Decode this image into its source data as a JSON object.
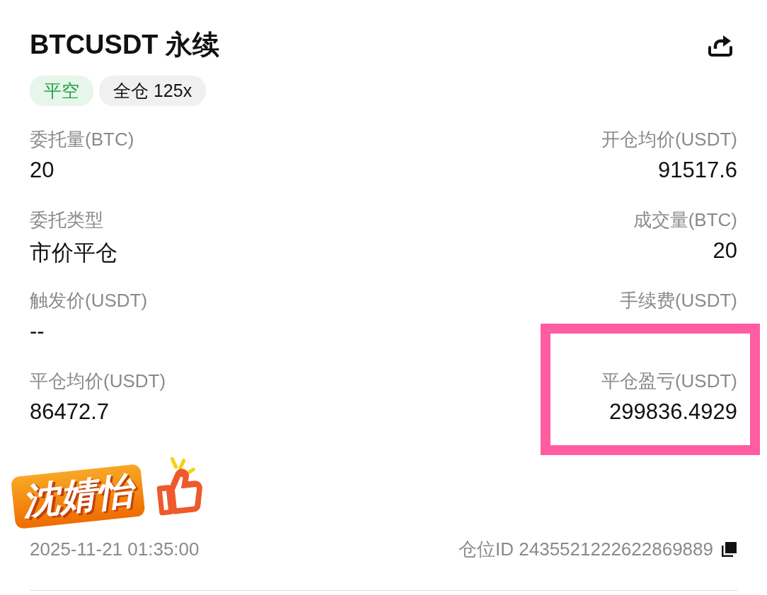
{
  "header": {
    "title": "BTCUSDT 永续"
  },
  "tags": [
    {
      "label": "平空",
      "kind": "side"
    },
    {
      "label": "全仓 125x",
      "kind": "margin"
    }
  ],
  "fields": [
    {
      "label": "委托量(BTC)",
      "value": "20",
      "highlighted": false
    },
    {
      "label": "开仓均价(USDT)",
      "value": "91517.6",
      "highlighted": false
    },
    {
      "label": "委托类型",
      "value": "市价平仓",
      "highlighted": false
    },
    {
      "label": "成交量(BTC)",
      "value": "20",
      "highlighted": false
    },
    {
      "label": "触发价(USDT)",
      "value": "--",
      "highlighted": false
    },
    {
      "label": "手续费(USDT)",
      "highlighted": false
    },
    {
      "label": "平仓均价(USDT)",
      "value": "86472.7",
      "highlighted": false
    },
    {
      "label": "平仓盈亏(USDT)",
      "value": "299836.4929",
      "highlighted": true
    }
  ],
  "sticker": {
    "text": "沈婧怡"
  },
  "footer": {
    "time": "2025-11-21 01:35:00",
    "position_id": "仓位ID 2435521222622869889"
  }
}
